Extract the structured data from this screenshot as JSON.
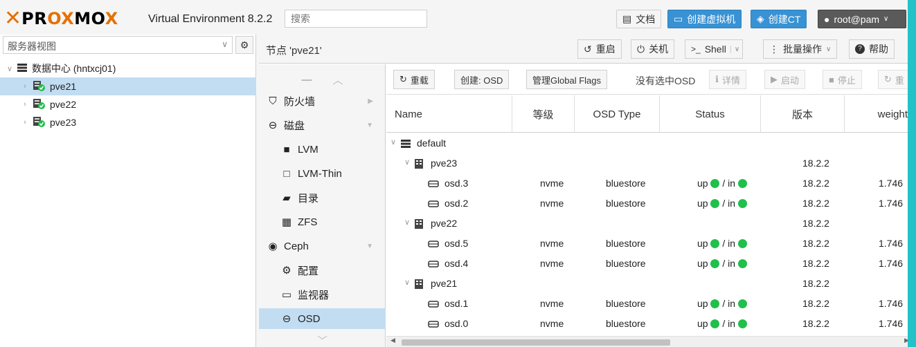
{
  "header": {
    "logo_text": "PROXMOX",
    "product": "Virtual Environment 8.2.2",
    "search_placeholder": "搜索",
    "docs_label": "文档",
    "create_vm_label": "创建虚拟机",
    "create_ct_label": "创建CT",
    "user_label": "root@pam"
  },
  "left": {
    "view_select": "服务器视图",
    "tree": [
      {
        "label": "数据中心 (hntxcj01)",
        "level": 0
      },
      {
        "label": "pve21",
        "level": 1,
        "selected": true
      },
      {
        "label": "pve22",
        "level": 1
      },
      {
        "label": "pve23",
        "level": 1
      }
    ]
  },
  "main": {
    "title": "节点 'pve21'",
    "reboot_label": "重启",
    "shutdown_label": "关机",
    "shell_label": "Shell",
    "bulk_label": "批量操作",
    "help_label": "帮助"
  },
  "nav": {
    "items": [
      {
        "label": "防火墙",
        "icon": "shield-icon"
      },
      {
        "label": "磁盘",
        "icon": "disk-icon"
      },
      {
        "label": "LVM",
        "icon": "square-icon"
      },
      {
        "label": "LVM-Thin",
        "icon": "square-outline-icon"
      },
      {
        "label": "目录",
        "icon": "folder-icon"
      },
      {
        "label": "ZFS",
        "icon": "grid-icon"
      },
      {
        "label": "Ceph",
        "icon": "ceph-icon"
      },
      {
        "label": "配置",
        "icon": "gear-icon"
      },
      {
        "label": "监视器",
        "icon": "monitor-icon"
      },
      {
        "label": "OSD",
        "icon": "disk-icon",
        "selected": true
      }
    ]
  },
  "toolbar": {
    "reload": "重载",
    "create_osd": "创建: OSD",
    "global_flags": "管理Global Flags",
    "no_selection": "没有选中OSD",
    "details": "详情",
    "start": "启动",
    "stop": "停止",
    "restart": "重"
  },
  "table": {
    "columns": [
      "Name",
      "等级",
      "OSD Type",
      "Status",
      "版本",
      "weight"
    ],
    "rows": [
      {
        "type": "root",
        "name": "default",
        "class": "",
        "osdtype": "",
        "status": "",
        "version": "",
        "weight": ""
      },
      {
        "type": "host",
        "name": "pve23",
        "class": "",
        "osdtype": "",
        "status": "",
        "version": "18.2.2",
        "weight": ""
      },
      {
        "type": "osd",
        "name": "osd.3",
        "class": "nvme",
        "osdtype": "bluestore",
        "status": "up",
        "version": "18.2.2",
        "weight": "1.746"
      },
      {
        "type": "osd",
        "name": "osd.2",
        "class": "nvme",
        "osdtype": "bluestore",
        "status": "up",
        "version": "18.2.2",
        "weight": "1.746"
      },
      {
        "type": "host",
        "name": "pve22",
        "class": "",
        "osdtype": "",
        "status": "",
        "version": "18.2.2",
        "weight": ""
      },
      {
        "type": "osd",
        "name": "osd.5",
        "class": "nvme",
        "osdtype": "bluestore",
        "status": "up",
        "version": "18.2.2",
        "weight": "1.746"
      },
      {
        "type": "osd",
        "name": "osd.4",
        "class": "nvme",
        "osdtype": "bluestore",
        "status": "up",
        "version": "18.2.2",
        "weight": "1.746"
      },
      {
        "type": "host",
        "name": "pve21",
        "class": "",
        "osdtype": "",
        "status": "",
        "version": "18.2.2",
        "weight": ""
      },
      {
        "type": "osd",
        "name": "osd.1",
        "class": "nvme",
        "osdtype": "bluestore",
        "status": "up",
        "version": "18.2.2",
        "weight": "1.746"
      },
      {
        "type": "osd",
        "name": "osd.0",
        "class": "nvme",
        "osdtype": "bluestore",
        "status": "up",
        "version": "18.2.2",
        "weight": "1.746"
      }
    ],
    "in_label": "/ in"
  },
  "colors": {
    "accent": "#e57000",
    "selection": "#c2ddf2",
    "primary_button": "#3892d4",
    "status_green": "#21bf4b"
  }
}
